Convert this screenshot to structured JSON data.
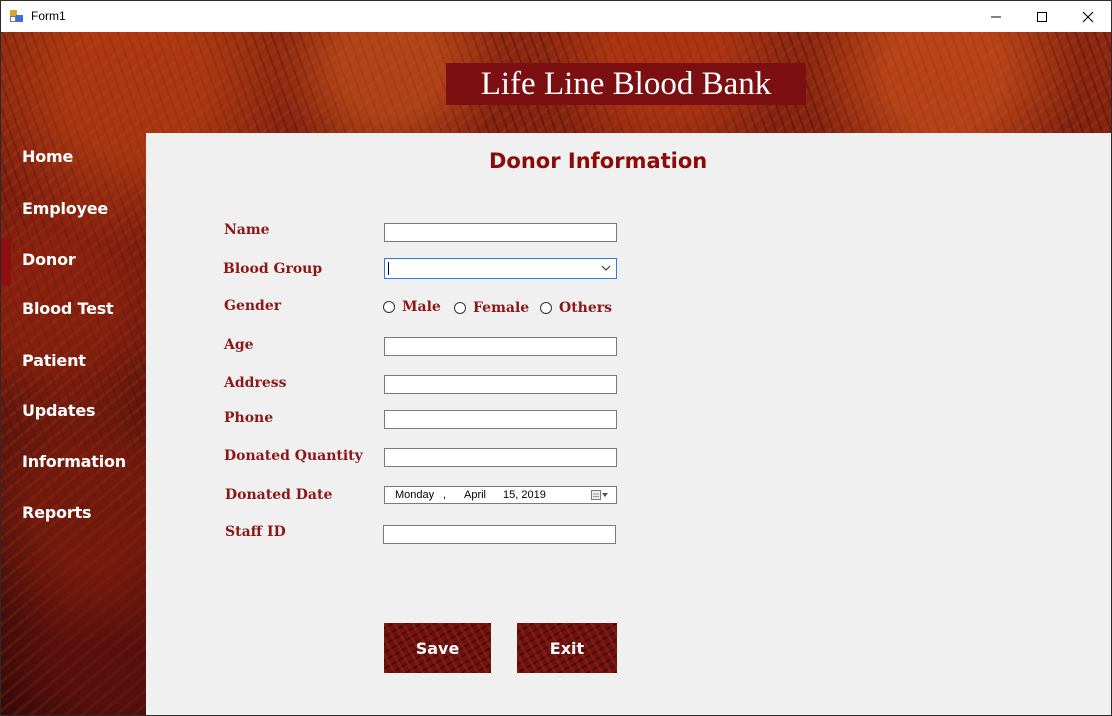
{
  "window": {
    "title": "Form1"
  },
  "header": {
    "title": "Life Line Blood Bank"
  },
  "nav": {
    "items": [
      {
        "label": "Home"
      },
      {
        "label": "Employee"
      },
      {
        "label": "Donor"
      },
      {
        "label": "Blood Test"
      },
      {
        "label": "Patient"
      },
      {
        "label": "Updates"
      },
      {
        "label": "Information"
      },
      {
        "label": "Reports"
      }
    ],
    "active": "Donor"
  },
  "form": {
    "title": "Donor Information",
    "labels": {
      "name": "Name",
      "blood_group": "Blood Group",
      "gender": "Gender",
      "age": "Age",
      "address": "Address",
      "phone": "Phone",
      "donated_quantity": "Donated Quantity",
      "donated_date": "Donated Date",
      "staff_id": "Staff ID"
    },
    "values": {
      "name": "",
      "blood_group": "",
      "age": "",
      "address": "",
      "phone": "",
      "donated_quantity": "",
      "staff_id": ""
    },
    "gender_options": [
      "Male",
      "Female",
      "Others"
    ],
    "date": {
      "weekday": "Monday",
      "month": "April",
      "day_year": "15, 2019"
    },
    "buttons": {
      "save": "Save",
      "exit": "Exit"
    }
  },
  "colors": {
    "accent": "#8b0b0b",
    "banner": "#7b0f12"
  }
}
